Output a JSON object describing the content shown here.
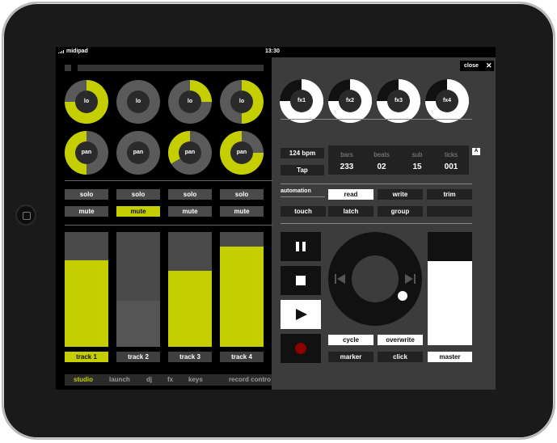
{
  "status": {
    "app": "midipad",
    "time": "13:30"
  },
  "close_label": "close",
  "knobs_row1": [
    "lo",
    "lo",
    "lo",
    "lo"
  ],
  "knobs_row2": [
    "pan",
    "pan",
    "pan",
    "pan"
  ],
  "knob_fx": [
    "fx1",
    "fx2",
    "fx3",
    "fx4"
  ],
  "solo": [
    "solo",
    "solo",
    "solo",
    "solo"
  ],
  "mute": [
    "mute",
    "mute",
    "mute",
    "mute"
  ],
  "tracks": [
    "track 1",
    "track 2",
    "track 3",
    "track 4"
  ],
  "bpm": "124 bpm",
  "tap": "Tap",
  "counter_headers": [
    "bars",
    "beats",
    "sub",
    "ticks"
  ],
  "counter_values": [
    "233",
    "02",
    "15",
    "001"
  ],
  "automation_label": "automation",
  "automation_buttons": [
    "read",
    "write",
    "trim",
    "touch",
    "latch",
    "group"
  ],
  "a_badge": "A",
  "transport_buttons": [
    "cycle",
    "overwrite",
    "marker",
    "click"
  ],
  "master": "master",
  "tabs": [
    "studio",
    "launch",
    "dj",
    "fx",
    "keys"
  ],
  "record_control": "record contro"
}
